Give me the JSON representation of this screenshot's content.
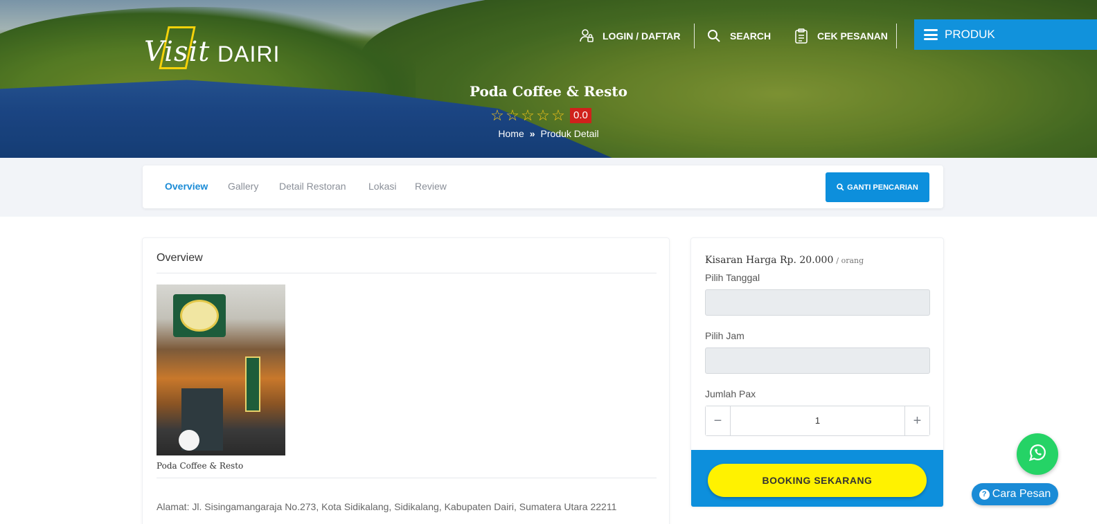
{
  "brand": {
    "logo_script": "Visit",
    "logo_word": "DAIRI"
  },
  "nav": {
    "login": "LOGIN / DAFTAR",
    "search": "SEARCH",
    "cek_pesanan": "CEK PESANAN",
    "produk": "PRODUK"
  },
  "hero": {
    "title": "Poda Coffee & Resto",
    "rating_stars": 5,
    "rating_filled": 0,
    "score": "0.0",
    "breadcrumb": {
      "home": "Home",
      "current": "Produk Detail"
    }
  },
  "tabs": [
    {
      "label": "Overview",
      "active": true
    },
    {
      "label": "Gallery",
      "active": false
    },
    {
      "label": "Detail Restoran",
      "active": false
    },
    {
      "label": "Lokasi",
      "active": false
    },
    {
      "label": "Review",
      "active": false
    }
  ],
  "ganti_pencarian": "GANTI PENCARIAN",
  "overview": {
    "heading": "Overview",
    "caption": "Poda Coffee & Resto",
    "alamat": "Alamat: Jl. Sisingamangaraja No.273, Kota Sidikalang, Sidikalang, Kabupaten Dairi, Sumatera Utara 22211"
  },
  "booking": {
    "harga_label": "Kisaran Harga Rp. 20.000",
    "harga_unit": "/ orang",
    "tanggal_label": "Pilih Tanggal",
    "tanggal_value": "",
    "jam_label": "Pilih Jam",
    "jam_value": "",
    "pax_label": "Jumlah Pax",
    "pax_value": "1",
    "minus": "−",
    "plus": "+",
    "button": "BOOKING SEKARANG"
  },
  "floating": {
    "cara_pesan": "Cara Pesan",
    "cara_icon": "?"
  },
  "colors": {
    "accent": "#0d8fdc",
    "booking_button": "#fff200",
    "score_badge": "#d0211c",
    "whatsapp": "#25d366",
    "star": "#f5c518"
  },
  "icons": [
    "user-lock-icon",
    "search-icon",
    "clipboard-icon",
    "menu-icon",
    "star-outline-icon",
    "double-chevron-right-icon",
    "whatsapp-icon",
    "question-circle-icon"
  ]
}
